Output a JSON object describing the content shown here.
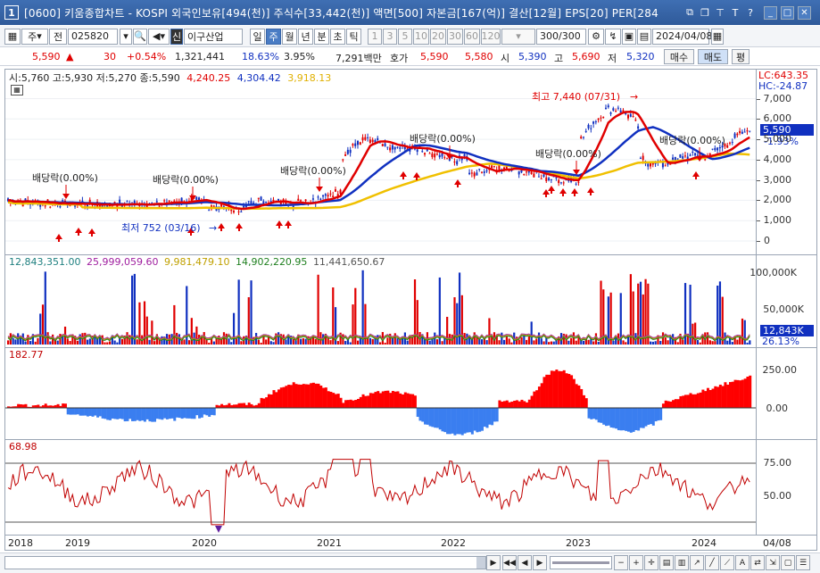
{
  "titlebar": {
    "number": "1",
    "title": "[0600] 키움종합차트 - KOSPI 외국인보유[494(천)] 주식수[33,442(천)] 액면[500] 자본금[167(억)] 결산[12월] EPS[20] PER[284"
  },
  "toolbar": {
    "code": "025820",
    "name": "이구산업",
    "type1": "주",
    "type2": "전",
    "periods": [
      "일",
      "주",
      "월",
      "년",
      "분",
      "초",
      "틱"
    ],
    "selected_period": "주",
    "numbers": [
      "1",
      "3",
      "5",
      "10",
      "20",
      "30",
      "60",
      "120"
    ],
    "count": "300",
    "count_max": "/300",
    "date": "2024/04/08",
    "name_badge": "신"
  },
  "quote": {
    "price": "5,590",
    "change": "30",
    "change_pct": "+0.54%",
    "volume": "1,321,441",
    "ratio1": "18.63%",
    "ratio2": "3.95%",
    "amount": "7,291백만",
    "ask_label": "호가",
    "ask": "5,590",
    "bid": "5,580",
    "open_label": "시",
    "open": "5,390",
    "high_label": "고",
    "high": "5,690",
    "low_label": "저",
    "low": "5,320",
    "buy_label": "매수",
    "sell_label": "매도",
    "eval_label": "평"
  },
  "price_pane": {
    "legend_ohlc": "시:5,760 고:5,930 저:5,270 종:5,590",
    "ma1": "4,240.25",
    "ma2": "4,304.42",
    "ma3": "3,918.13",
    "lc": "LC:643.35",
    "hc": "HC:-24.87",
    "current": "5,590",
    "current_pct": "-1.93%",
    "high_label": "최고 7,440 (07/31)",
    "low_label": "최저 752 (03/16)",
    "dividend_label": "배당락(0.00%)",
    "yticks": [
      "7,000",
      "6,000",
      "5,000",
      "4,000",
      "3,000",
      "2,000",
      "1,000",
      "0"
    ]
  },
  "volume_pane": {
    "v1": "12,843,351.00",
    "v2": "25,999,059.60",
    "v3": "9,981,479.10",
    "v4": "14,902,220.95",
    "v5": "11,441,650.67",
    "yticks": [
      "100,000K",
      "50,000K"
    ],
    "current": "12,843K",
    "current_pct": "26.13%"
  },
  "osc_pane": {
    "value": "182.77",
    "yticks": [
      "250.00",
      "0.00"
    ]
  },
  "rsi_pane": {
    "value": "68.98",
    "yticks": [
      "75.00",
      "50.00"
    ]
  },
  "xaxis": {
    "labels": [
      "2018",
      "2019",
      "2020",
      "2021",
      "2022",
      "2023",
      "2024",
      "04/08"
    ]
  },
  "colors": {
    "up": "#e00000",
    "down": "#1030c0",
    "ma_red": "#e00000",
    "ma_blue": "#1030c0",
    "ma_yellow": "#f0c000",
    "osc_pos": "#ff0000",
    "osc_neg": "#3a7ef0"
  }
}
